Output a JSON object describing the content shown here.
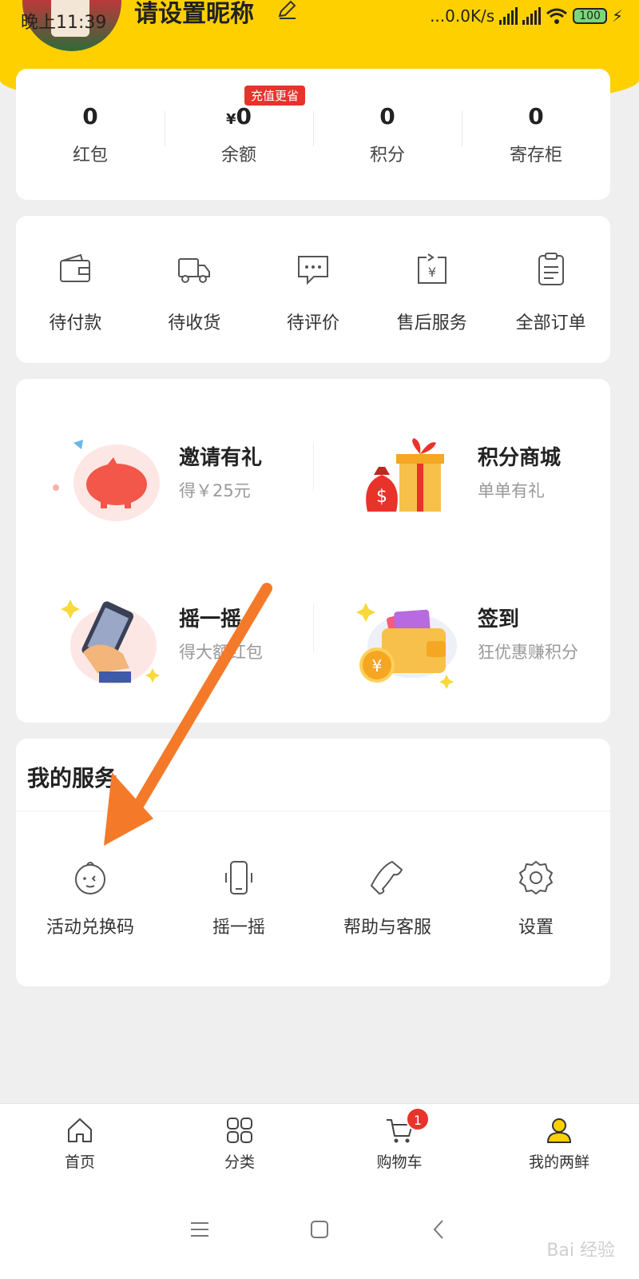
{
  "status_bar": {
    "time": "晚上11:39",
    "network_speed": "...0.0K/s",
    "battery": "100"
  },
  "profile": {
    "nickname": "请设置昵称"
  },
  "assets": {
    "promo_badge": "充值更省",
    "items": [
      {
        "value": "0",
        "prefix": "",
        "label": "红包"
      },
      {
        "value": "0",
        "prefix": "¥",
        "label": "余额"
      },
      {
        "value": "0",
        "prefix": "",
        "label": "积分"
      },
      {
        "value": "0",
        "prefix": "",
        "label": "寄存柜"
      }
    ]
  },
  "orders": {
    "items": [
      {
        "label": "待付款",
        "icon": "wallet-icon"
      },
      {
        "label": "待收货",
        "icon": "truck-icon"
      },
      {
        "label": "待评价",
        "icon": "comment-icon"
      },
      {
        "label": "售后服务",
        "icon": "yuan-exchange-icon"
      },
      {
        "label": "全部订单",
        "icon": "clipboard-icon"
      }
    ]
  },
  "promos": {
    "items": [
      {
        "title": "邀请有礼",
        "subtitle": "得￥25元",
        "icon": "piggy-bank-icon"
      },
      {
        "title": "积分商城",
        "subtitle": "单单有礼",
        "icon": "gift-bag-icon"
      },
      {
        "title": "摇一摇",
        "subtitle": "得大额红包",
        "icon": "shake-phone-icon"
      },
      {
        "title": "签到",
        "subtitle": "狂优惠赚积分",
        "icon": "wallet-coin-icon"
      }
    ]
  },
  "services": {
    "title": "我的服务",
    "items": [
      {
        "label": "活动兑换码",
        "icon": "face-icon"
      },
      {
        "label": "摇一摇",
        "icon": "phone-vibrate-icon"
      },
      {
        "label": "帮助与客服",
        "icon": "phone-handset-icon"
      },
      {
        "label": "设置",
        "icon": "gear-icon"
      }
    ]
  },
  "tabbar": {
    "items": [
      {
        "label": "首页",
        "icon": "home-icon"
      },
      {
        "label": "分类",
        "icon": "grid-icon"
      },
      {
        "label": "购物车",
        "icon": "cart-icon",
        "badge": "1"
      },
      {
        "label": "我的两鲜",
        "icon": "user-icon",
        "active_color": "#ffd000"
      }
    ]
  },
  "watermark": "Bai 经验",
  "colors": {
    "brand_yellow": "#ffd000",
    "badge_red": "#e8332b",
    "arrow_orange": "#f47a2a"
  }
}
